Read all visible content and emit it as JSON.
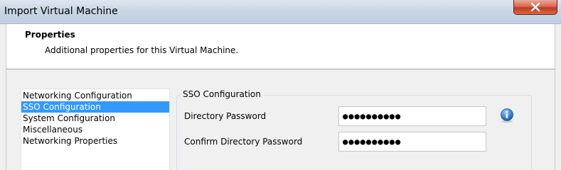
{
  "window": {
    "title": "Import Virtual Machine"
  },
  "header": {
    "title": "Properties",
    "subtitle": "Additional properties for this Virtual Machine."
  },
  "nav": {
    "items": [
      {
        "label": "Networking Configuration",
        "selected": false
      },
      {
        "label": "SSO Configuration",
        "selected": true
      },
      {
        "label": "System Configuration",
        "selected": false
      },
      {
        "label": "Miscellaneous",
        "selected": false
      },
      {
        "label": "Networking Properties",
        "selected": false
      }
    ]
  },
  "sso": {
    "legend": "SSO Configuration",
    "directory_password_label": "Directory Password",
    "directory_password_value": "●●●●●●●●●●",
    "confirm_password_label": "Confirm Directory Password",
    "confirm_password_value": "●●●●●●●●●●"
  },
  "icons": {
    "close": "close-icon",
    "info": "info-icon"
  },
  "colors": {
    "selection": "#3399ff",
    "close_button": "#c94a2e",
    "info_icon": "#2c6fb7"
  }
}
